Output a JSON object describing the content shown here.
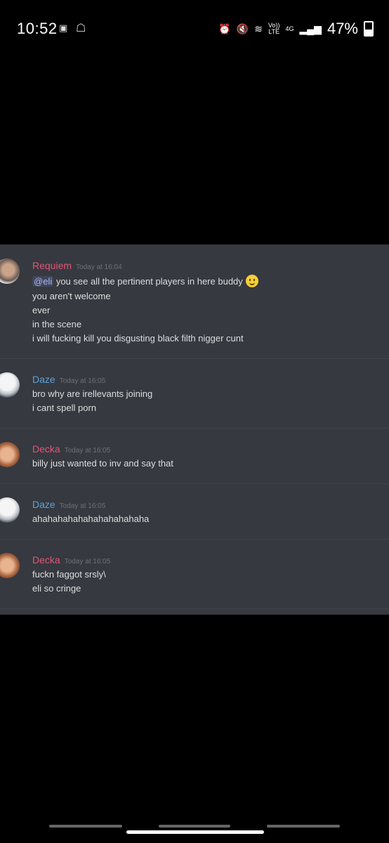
{
  "status_bar": {
    "time": "10:52",
    "left_icons": [
      "afl-app-icon",
      "snapchat-icon"
    ],
    "network_label_top": "Vo))",
    "network_label_bottom": "LTE",
    "data_label": "4G",
    "battery_percent": "47%"
  },
  "messages": [
    {
      "author": "Requiem",
      "author_color": "#e0557a",
      "timestamp": "Today at 16:04",
      "mention": "@eli",
      "lines": [
        "you see all the pertinent players in here buddy",
        "you aren't welcome",
        "ever",
        "in the scene",
        "i will fucking kill you disgusting black filth nigger cunt"
      ],
      "emoji": "smiling-face-emoji"
    },
    {
      "author": "Daze",
      "author_color": "#5ea0d8",
      "timestamp": "Today at 16:05",
      "lines": [
        "bro why are irellevants joining",
        "i cant spell porn"
      ]
    },
    {
      "author": "Decka",
      "author_color": "#e0557a",
      "timestamp": "Today at 16:05",
      "lines": [
        "billy just wanted to inv and say that"
      ]
    },
    {
      "author": "Daze",
      "author_color": "#5ea0d8",
      "timestamp": "Today at 16:05",
      "lines": [
        "ahahahahahahahahahahaha"
      ]
    },
    {
      "author": "Decka",
      "author_color": "#e0557a",
      "timestamp": "Today at 16:05",
      "lines": [
        "fuckn faggot srsly\\",
        "eli so cringe"
      ]
    }
  ]
}
